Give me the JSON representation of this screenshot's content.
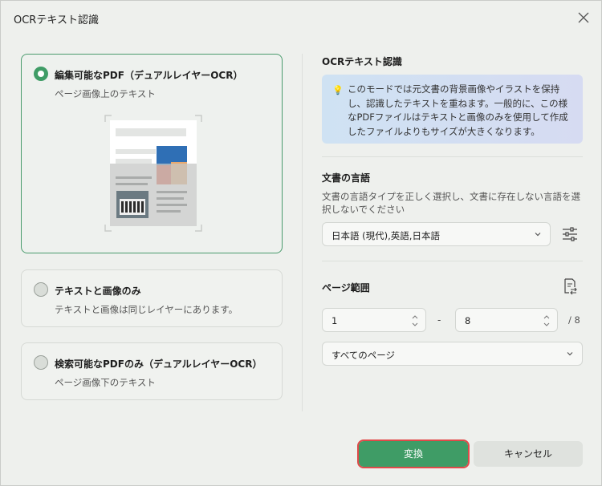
{
  "window": {
    "title": "OCRテキスト認識"
  },
  "options": [
    {
      "title": "編集可能なPDF（デュアルレイヤーOCR）",
      "subtitle": "ページ画像上のテキスト",
      "selected": true
    },
    {
      "title": "テキストと画像のみ",
      "subtitle": "テキストと画像は同じレイヤーにあります。",
      "selected": false
    },
    {
      "title": "検索可能なPDFのみ（デュアルレイヤーOCR）",
      "subtitle": "ページ画像下のテキスト",
      "selected": false
    }
  ],
  "ocr_section": {
    "title": "OCRテキスト認識",
    "info": "このモードでは元文書の背景画像やイラストを保持し、認識したテキストを重ねます。一般的に、この様なPDFファイルはテキストと画像のみを使用して作成したファイルよりもサイズが大きくなります。"
  },
  "language_section": {
    "title": "文書の言語",
    "description": "文書の言語タイプを正しく選択し、文書に存在しない言語を選択しないでください",
    "selected": "日本語 (現代),英語,日本語"
  },
  "page_range_section": {
    "title": "ページ範囲",
    "from": "1",
    "to": "8",
    "dash": "-",
    "total": "/ 8",
    "scope": "すべてのページ"
  },
  "buttons": {
    "convert": "変換",
    "cancel": "キャンセル"
  },
  "colors": {
    "accent": "#3f9c66",
    "highlight": "#e04a4a",
    "info_bg": "#cfe2f3"
  }
}
